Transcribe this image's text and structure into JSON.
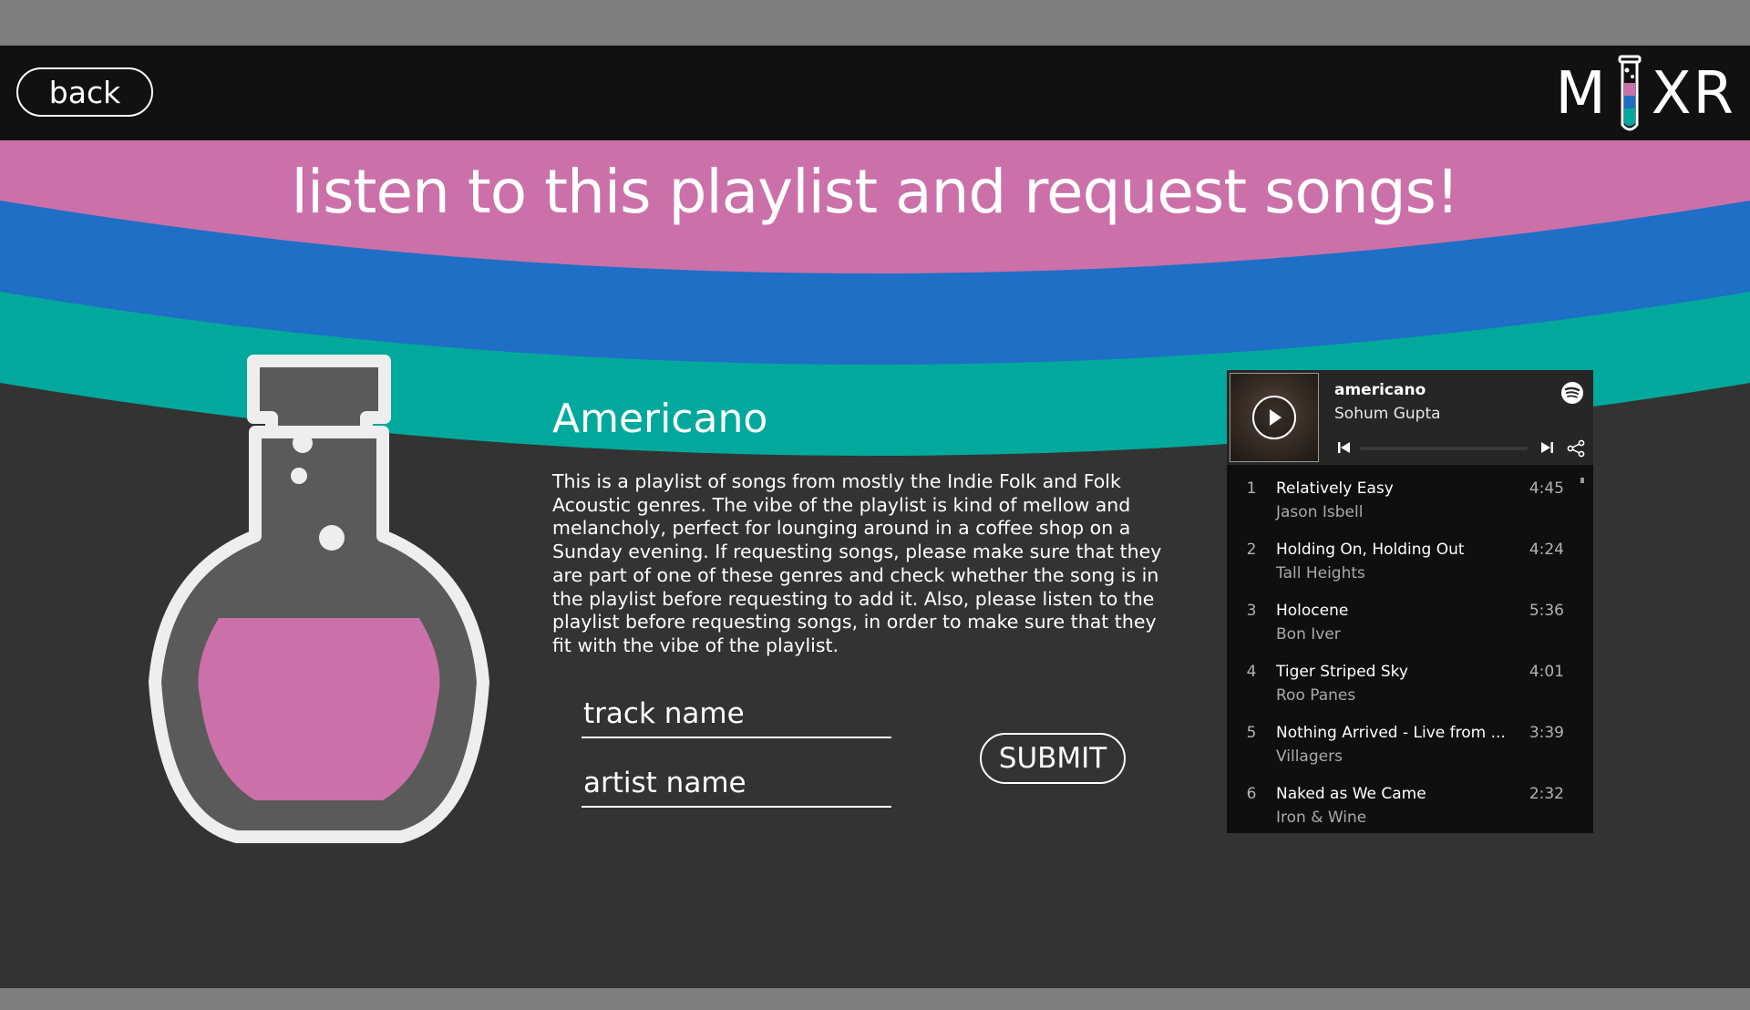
{
  "header": {
    "back_label": "back",
    "logo_text_left": "M",
    "logo_text_right": "XR"
  },
  "page": {
    "title": "listen to this playlist and request songs!"
  },
  "colors": {
    "pink": "#cb70a9",
    "blue": "#1f6fc6",
    "teal": "#00a99c",
    "background": "#333333",
    "header": "#111111"
  },
  "playlist": {
    "name": "Americano",
    "description": "This is a playlist of songs from mostly the Indie Folk and Folk Acoustic genres. The vibe of the playlist is kind of mellow and melancholy, perfect for lounging around in a coffee shop on a Sunday evening. If requesting songs, please make sure that they are part of one of these genres and check whether the song is in the playlist before requesting to add it. Also, please listen to the playlist before requesting songs, in order to make sure that they fit with the vibe of the playlist."
  },
  "form": {
    "track_placeholder": "track name",
    "artist_placeholder": "artist name",
    "submit_label": "SUBMIT"
  },
  "spotify": {
    "playlist_title": "americano",
    "owner": "Sohum Gupta",
    "tracks": [
      {
        "num": "1",
        "name": "Relatively Easy",
        "artist": "Jason Isbell",
        "duration": "4:45"
      },
      {
        "num": "2",
        "name": "Holding On, Holding Out",
        "artist": "Tall Heights",
        "duration": "4:24"
      },
      {
        "num": "3",
        "name": "Holocene",
        "artist": "Bon Iver",
        "duration": "5:36"
      },
      {
        "num": "4",
        "name": "Tiger Striped Sky",
        "artist": "Roo Panes",
        "duration": "4:01"
      },
      {
        "num": "5",
        "name": "Nothing Arrived - Live from ...",
        "artist": "Villagers",
        "duration": "3:39"
      },
      {
        "num": "6",
        "name": "Naked as We Came",
        "artist": "Iron & Wine",
        "duration": "2:32"
      }
    ]
  }
}
